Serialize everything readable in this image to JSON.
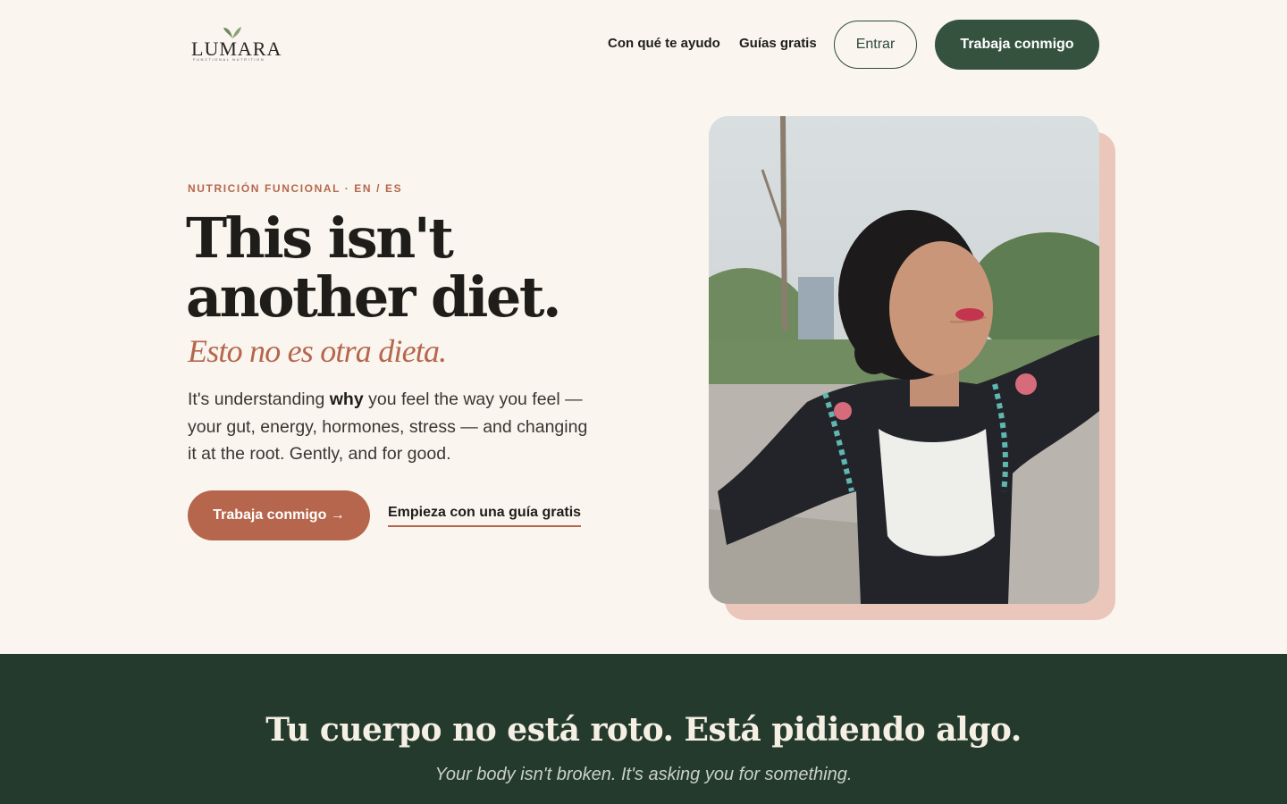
{
  "brand": {
    "name": "LUMARA",
    "tagline": "FUNCTIONAL NUTRITION"
  },
  "nav": {
    "links": [
      "Con qué te ayudo",
      "Guías gratis"
    ],
    "login_label": "Entrar",
    "cta_label": "Trabaja conmigo"
  },
  "hero": {
    "eyebrow": "NUTRICIÓN FUNCIONAL · EN / ES",
    "headline": "This isn't another diet.",
    "subheadline": "Esto no es otra dieta.",
    "body_before": "It's understanding ",
    "body_bold": "why",
    "body_after": " you feel the way you feel — your gut, energy, hormones, stress — and changing it at the root. Gently, and for good.",
    "primary_cta": "Trabaja conmigo →",
    "secondary_cta": "Empieza con una guía gratis"
  },
  "band": {
    "title": "Tu cuerpo no está roto. Está pidiendo algo.",
    "subtitle": "Your body isn't broken. It's asking you for something."
  },
  "colors": {
    "background": "#faf6ef",
    "forest": "#35523f",
    "terracotta": "#b6664c",
    "dark_band": "#233a2c",
    "blush": "#ebc7bb"
  }
}
